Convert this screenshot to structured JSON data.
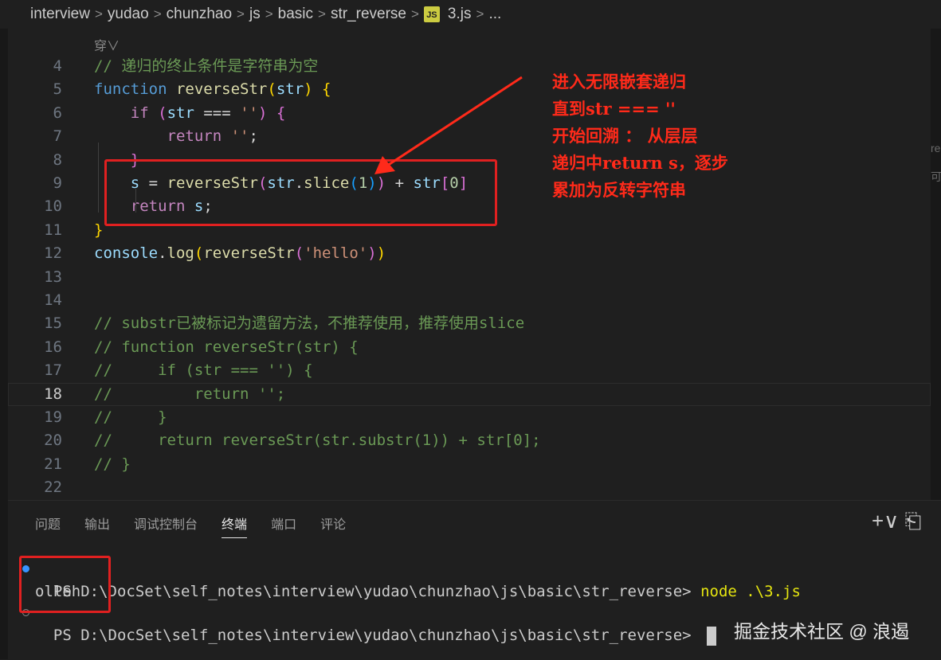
{
  "breadcrumb": [
    "interview",
    "yudao",
    "chunzhao",
    "js",
    "basic",
    "str_reverse",
    "3.js",
    "..."
  ],
  "file_icon": "JS",
  "peek_text": "穿∨",
  "code_lines": [
    {
      "n": "4",
      "tokens": [
        [
          "cm",
          "// 递归的终止条件是字符串为空"
        ]
      ]
    },
    {
      "n": "5",
      "tokens": [
        [
          "kw",
          "function"
        ],
        [
          "pl",
          " "
        ],
        [
          "fn",
          "reverseStr"
        ],
        [
          "b1",
          "("
        ],
        [
          "vr",
          "str"
        ],
        [
          "b1",
          ")"
        ],
        [
          "pl",
          " "
        ],
        [
          "b1",
          "{"
        ]
      ]
    },
    {
      "n": "6",
      "tokens": [
        [
          "pl",
          "    "
        ],
        [
          "ctl",
          "if"
        ],
        [
          "pl",
          " "
        ],
        [
          "b2",
          "("
        ],
        [
          "vr",
          "str"
        ],
        [
          "pl",
          " === "
        ],
        [
          "st",
          "''"
        ],
        [
          "b2",
          ")"
        ],
        [
          "pl",
          " "
        ],
        [
          "b2",
          "{"
        ]
      ]
    },
    {
      "n": "7",
      "tokens": [
        [
          "pl",
          "        "
        ],
        [
          "ctl",
          "return"
        ],
        [
          "pl",
          " "
        ],
        [
          "st",
          "''"
        ],
        [
          "pl",
          ";"
        ]
      ]
    },
    {
      "n": "8",
      "tokens": [
        [
          "pl",
          "    "
        ],
        [
          "b2",
          "}"
        ]
      ]
    },
    {
      "n": "9",
      "tokens": [
        [
          "pl",
          "    "
        ],
        [
          "vr",
          "s"
        ],
        [
          "pl",
          " = "
        ],
        [
          "fn",
          "reverseStr"
        ],
        [
          "b2",
          "("
        ],
        [
          "vr",
          "str"
        ],
        [
          "pl",
          "."
        ],
        [
          "fn",
          "slice"
        ],
        [
          "b3",
          "("
        ],
        [
          "nm",
          "1"
        ],
        [
          "b3",
          ")"
        ],
        [
          "b2",
          ")"
        ],
        [
          "pl",
          " + "
        ],
        [
          "vr",
          "str"
        ],
        [
          "b2",
          "["
        ],
        [
          "nm",
          "0"
        ],
        [
          "b2",
          "]"
        ]
      ]
    },
    {
      "n": "10",
      "tokens": [
        [
          "pl",
          "    "
        ],
        [
          "ctl",
          "return"
        ],
        [
          "pl",
          " "
        ],
        [
          "vr",
          "s"
        ],
        [
          "pl",
          ";"
        ]
      ]
    },
    {
      "n": "11",
      "tokens": [
        [
          "b1",
          "}"
        ]
      ]
    },
    {
      "n": "12",
      "tokens": [
        [
          "vr",
          "console"
        ],
        [
          "pl",
          "."
        ],
        [
          "fn",
          "log"
        ],
        [
          "b1",
          "("
        ],
        [
          "fn",
          "reverseStr"
        ],
        [
          "b2",
          "("
        ],
        [
          "st",
          "'hello'"
        ],
        [
          "b2",
          ")"
        ],
        [
          "b1",
          ")"
        ]
      ]
    },
    {
      "n": "13",
      "tokens": []
    },
    {
      "n": "14",
      "tokens": []
    },
    {
      "n": "15",
      "tokens": [
        [
          "cm",
          "// substr已被标记为遗留方法，不推荐使用，推荐使用slice"
        ]
      ]
    },
    {
      "n": "16",
      "tokens": [
        [
          "cm",
          "// function reverseStr(str) {"
        ]
      ]
    },
    {
      "n": "17",
      "tokens": [
        [
          "cm",
          "//     if (str === '') {"
        ]
      ]
    },
    {
      "n": "18",
      "tokens": [
        [
          "cm",
          "//         return '';"
        ]
      ]
    },
    {
      "n": "19",
      "tokens": [
        [
          "cm",
          "//     }"
        ]
      ]
    },
    {
      "n": "20",
      "tokens": [
        [
          "cm",
          "//     return reverseStr(str.substr(1)) + str[0];"
        ]
      ]
    },
    {
      "n": "21",
      "tokens": [
        [
          "cm",
          "// }"
        ]
      ]
    },
    {
      "n": "22",
      "tokens": []
    }
  ],
  "current_line": "18",
  "panel_tabs": [
    "问题",
    "输出",
    "调试控制台",
    "终端",
    "端口",
    "评论"
  ],
  "active_tab": "终端",
  "panel_actions": "+∨  ⎗",
  "terminal": {
    "prompt1": "PS D:\\DocSet\\self_notes\\interview\\yudao\\chunzhao\\js\\basic\\str_reverse> ",
    "command": "node .\\3.js",
    "output": "olleh",
    "prompt2": "PS D:\\DocSet\\self_notes\\interview\\yudao\\chunzhao\\js\\basic\\str_reverse> "
  },
  "annotation_lines": [
    "进入无限嵌套递归",
    "直到str === ''",
    "开始回溯 ： 从层层",
    "递归中return s，逐步",
    "累加为反转字符串"
  ],
  "watermark": "掘金技术社区 @ 浪遏",
  "right_edge_text": [
    "re",
    "可"
  ],
  "colors": {
    "annotation": "#ff2a1a",
    "box": "#e02020",
    "terminal_dot": "#3794ff"
  }
}
